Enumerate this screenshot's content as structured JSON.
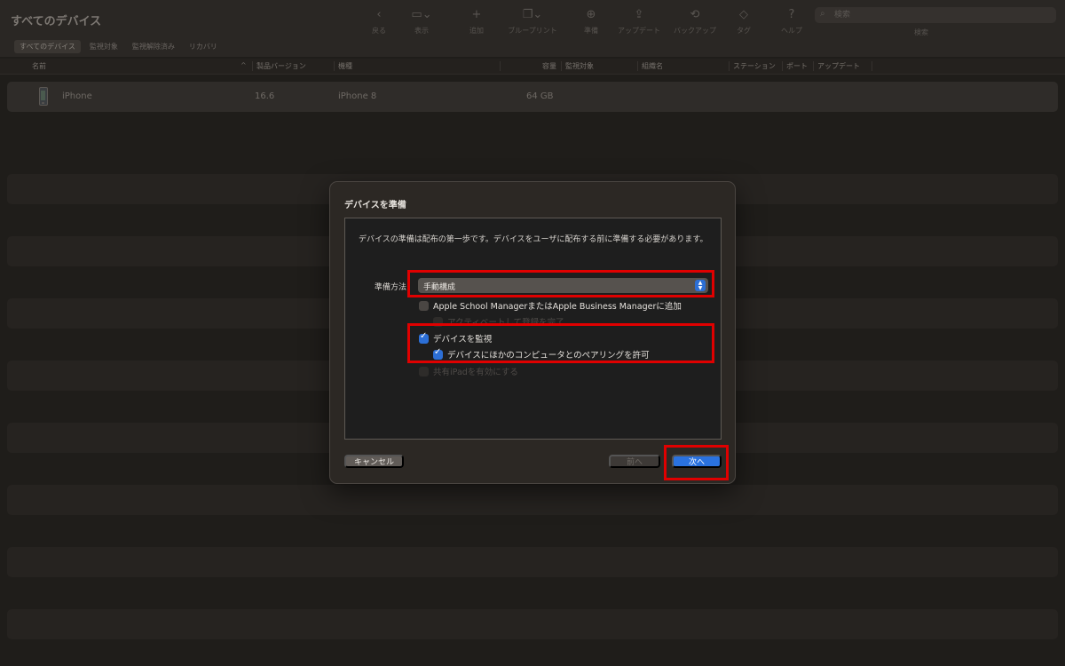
{
  "window": {
    "title": "すべてのデバイス"
  },
  "toolbar": {
    "items": [
      {
        "label": "戻る",
        "icon": "‹"
      },
      {
        "label": "表示",
        "icon": "▭⌄"
      },
      {
        "label": "追加",
        "icon": "+"
      },
      {
        "label": "ブループリント",
        "icon": "❐⌄"
      },
      {
        "label": "準備",
        "icon": "⊕"
      },
      {
        "label": "アップデート",
        "icon": "⇪"
      },
      {
        "label": "バックアップ",
        "icon": "⟲"
      },
      {
        "label": "タグ",
        "icon": "◇"
      },
      {
        "label": "ヘルプ",
        "icon": "?"
      }
    ],
    "search": {
      "placeholder": "検索",
      "label": "検索"
    }
  },
  "filter_tabs": [
    "すべてのデバイス",
    "監視対象",
    "監視解除済み",
    "リカバリ"
  ],
  "table": {
    "columns": [
      "名前",
      "製品バージョン",
      "機種",
      "容量",
      "監視対象",
      "組織名",
      "ステーション",
      "ポート",
      "アップデート"
    ],
    "rows": [
      {
        "name": "iPhone",
        "version": "16.6",
        "model": "iPhone 8",
        "capacity": "64 GB"
      }
    ]
  },
  "dialog": {
    "title": "デバイスを準備",
    "description": "デバイスの準備は配布の第一歩です。デバイスをユーザに配布する前に準備する必要があります。",
    "method_label": "準備方法:",
    "method_value": "手動構成",
    "options": {
      "abm": "Apple School ManagerまたはApple Business Managerに追加",
      "activate": "アクティベートして登録を完了",
      "supervise": "デバイスを監視",
      "pairing": "デバイスにほかのコンピュータとのペアリングを許可",
      "shared_ipad": "共有iPadを有効にする"
    },
    "buttons": {
      "cancel": "キャンセル",
      "previous": "前へ",
      "next": "次へ"
    }
  },
  "colors": {
    "accent": "#2a72e0",
    "highlight": "#e00000",
    "background": "#1f1d1a"
  }
}
